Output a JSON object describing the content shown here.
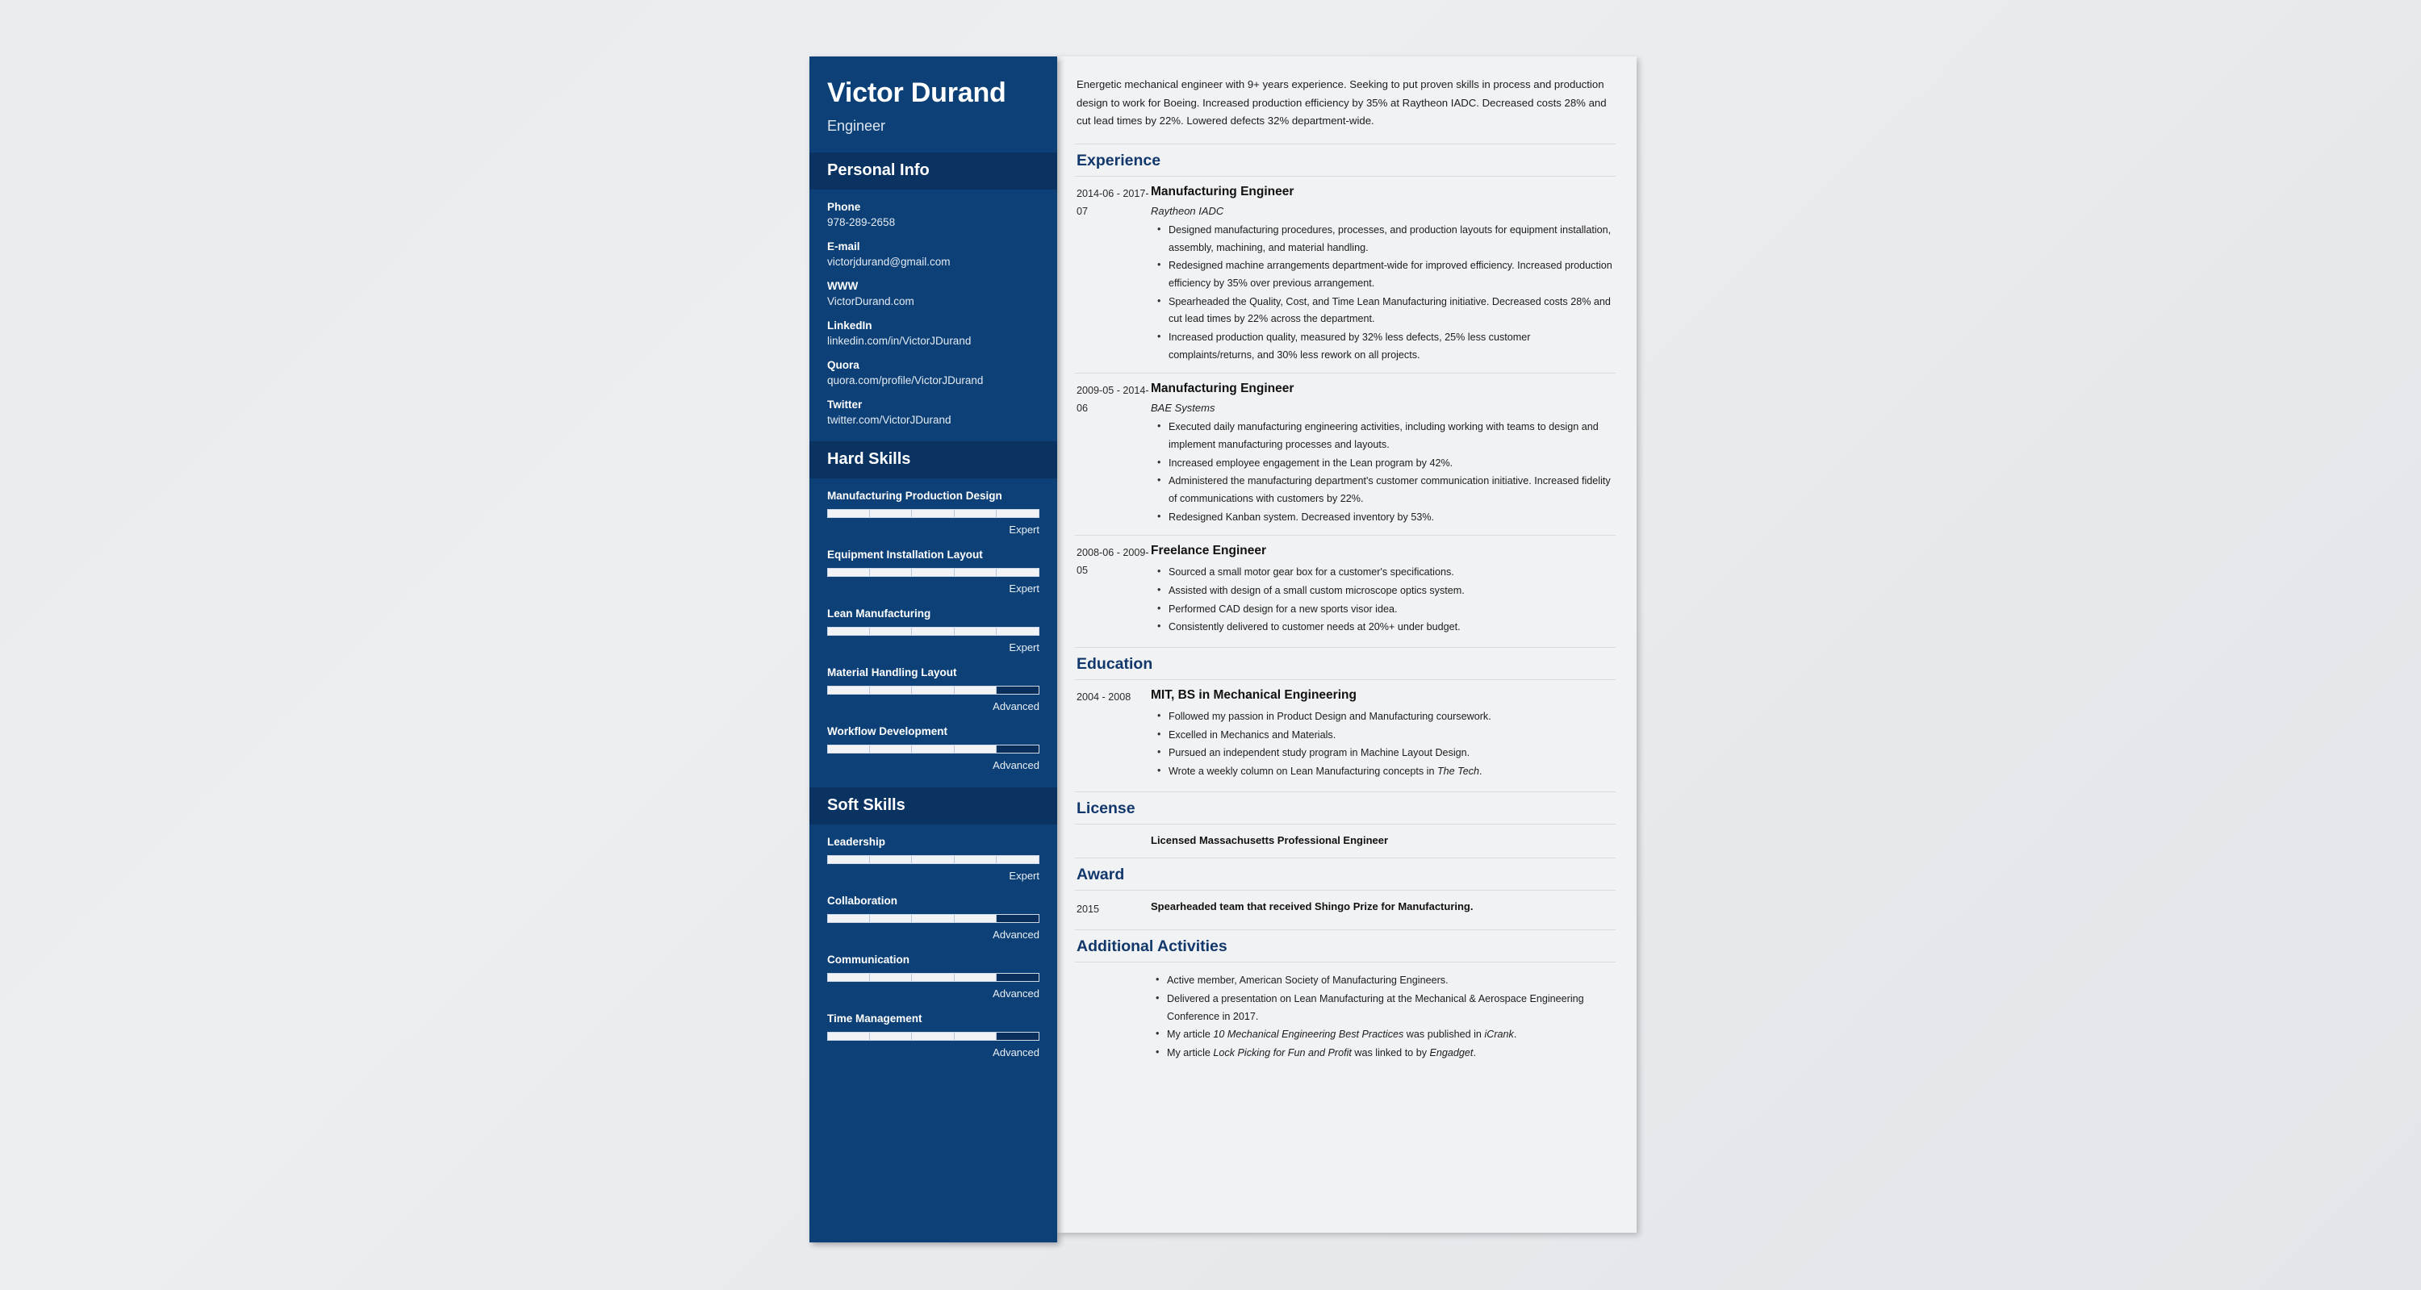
{
  "sidebar": {
    "name": "Victor Durand",
    "role": "Engineer",
    "personal_info": {
      "title": "Personal Info",
      "items": [
        {
          "label": "Phone",
          "value": "978-289-2658"
        },
        {
          "label": "E-mail",
          "value": "victorjdurand@gmail.com"
        },
        {
          "label": "WWW",
          "value": "VictorDurand.com"
        },
        {
          "label": "LinkedIn",
          "value": "linkedin.com/in/VictorJDurand"
        },
        {
          "label": "Quora",
          "value": "quora.com/profile/VictorJDurand"
        },
        {
          "label": "Twitter",
          "value": "twitter.com/VictorJDurand"
        }
      ]
    },
    "hard_skills": {
      "title": "Hard Skills",
      "items": [
        {
          "name": "Manufacturing Production Design",
          "level": "Expert",
          "filled": 5,
          "total": 5
        },
        {
          "name": "Equipment Installation Layout",
          "level": "Expert",
          "filled": 5,
          "total": 5
        },
        {
          "name": "Lean Manufacturing",
          "level": "Expert",
          "filled": 5,
          "total": 5
        },
        {
          "name": "Material Handling Layout",
          "level": "Advanced",
          "filled": 4,
          "total": 5
        },
        {
          "name": "Workflow Development",
          "level": "Advanced",
          "filled": 4,
          "total": 5
        }
      ]
    },
    "soft_skills": {
      "title": "Soft Skills",
      "items": [
        {
          "name": "Leadership",
          "level": "Expert",
          "filled": 5,
          "total": 5
        },
        {
          "name": "Collaboration",
          "level": "Advanced",
          "filled": 4,
          "total": 5
        },
        {
          "name": "Communication",
          "level": "Advanced",
          "filled": 4,
          "total": 5
        },
        {
          "name": "Time Management",
          "level": "Advanced",
          "filled": 4,
          "total": 5
        }
      ]
    }
  },
  "main": {
    "summary": "Energetic mechanical engineer with 9+ years experience. Seeking to put proven skills in process and production design to work for Boeing. Increased production efficiency by 35% at Raytheon IADC. Decreased costs 28% and cut lead times by 22%. Lowered defects 32% department-wide.",
    "experience": {
      "title": "Experience",
      "entries": [
        {
          "date": "2014-06 - 2017-07",
          "title": "Manufacturing Engineer",
          "company": "Raytheon IADC",
          "bullets": [
            "Designed manufacturing procedures, processes, and production layouts for equipment installation, assembly, machining, and material handling.",
            "Redesigned machine arrangements department-wide for improved efficiency. Increased production efficiency by 35% over previous arrangement.",
            "Spearheaded the Quality, Cost, and Time Lean Manufacturing initiative. Decreased costs 28% and cut lead times by 22% across the department.",
            "Increased production quality, measured by 32% less defects, 25% less customer complaints/returns, and 30% less rework on all projects."
          ]
        },
        {
          "date": "2009-05 - 2014-06",
          "title": "Manufacturing Engineer",
          "company": "BAE Systems",
          "bullets": [
            "Executed daily manufacturing engineering activities, including working with teams to design and implement manufacturing processes and layouts.",
            "Increased employee engagement in the Lean program by 42%.",
            "Administered the manufacturing department's customer communication initiative. Increased fidelity of communications with customers by 22%.",
            "Redesigned Kanban system. Decreased inventory by 53%."
          ]
        },
        {
          "date": "2008-06 - 2009-05",
          "title": "Freelance Engineer",
          "company": "",
          "bullets": [
            "Sourced a small motor gear box for a customer's specifications.",
            "Assisted with design of a small custom microscope optics system.",
            "Performed CAD design for a new sports visor idea.",
            "Consistently delivered to customer needs at 20%+ under budget."
          ]
        }
      ]
    },
    "education": {
      "title": "Education",
      "entries": [
        {
          "date": "2004 - 2008",
          "title": "MIT, BS in Mechanical Engineering",
          "bullets": [
            "Followed my passion in Product Design and Manufacturing coursework.",
            "Excelled in Mechanics and Materials.",
            "Pursued an independent study program in Machine Layout Design.",
            "Wrote a weekly column on Lean Manufacturing concepts in The Tech."
          ]
        }
      ]
    },
    "license": {
      "title": "License",
      "date": "",
      "text": "Licensed Massachusetts Professional Engineer"
    },
    "award": {
      "title": "Award",
      "date": "2015",
      "text": "Spearheaded team that received Shingo Prize for Manufacturing."
    },
    "additional_activities": {
      "title": "Additional Activities",
      "bullets": [
        "Active member, American Society of Manufacturing Engineers.",
        "Delivered a presentation on Lean Manufacturing at the Mechanical & Aerospace Engineering Conference in 2017.",
        "My article 10 Mechanical Engineering Best Practices was published in iCrank.",
        "My article Lock Picking for Fun and Profit was linked to by Engadget."
      ]
    }
  },
  "colors": {
    "sidebar_blue": "#0c4077",
    "sidebar_dark": "#0a3362",
    "heading_navy": "#12386b",
    "paper": "#f1f2f4"
  }
}
